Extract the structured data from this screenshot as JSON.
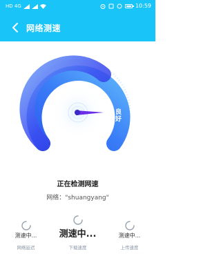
{
  "status_bar": {
    "left_text": "HD 4G",
    "time": "10:59"
  },
  "header": {
    "title": "网络测速"
  },
  "gauge": {
    "rating": "良好"
  },
  "main": {
    "status_text": "正在检测网速",
    "network_label": "网络：",
    "network_name": "\"shuangyang\""
  },
  "metrics": [
    {
      "value": "测速中...",
      "label": "网络延迟"
    },
    {
      "value": "测速中...",
      "label": "下载速度"
    },
    {
      "value": "测速中...",
      "label": "上传速度"
    }
  ],
  "colors": {
    "accent": "#19c4f8",
    "gauge_inner": "#2f3ee3",
    "gauge_outer": "#3aa3f8",
    "needle": "#6a2ee8"
  }
}
